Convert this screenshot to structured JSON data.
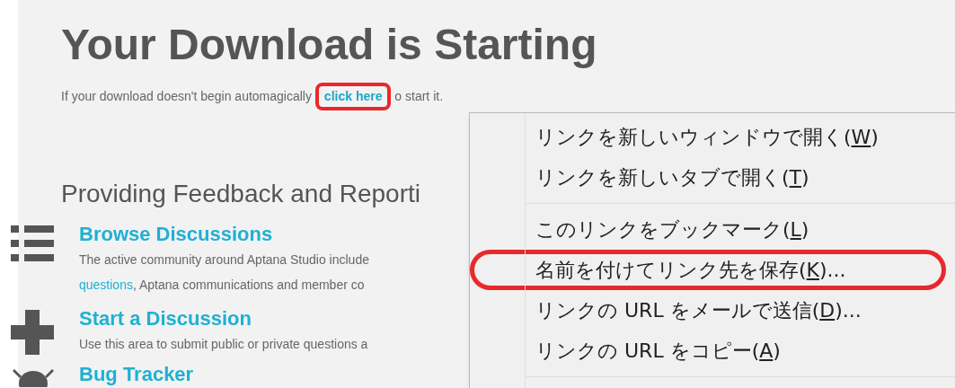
{
  "page": {
    "title": "Your Download is Starting",
    "intro": {
      "before": "If your download doesn't begin automagically",
      "link": "click here",
      "after": "o start it."
    },
    "section_heading": "Providing Feedback and Reporti",
    "items": [
      {
        "kind": "list",
        "title": "Browse Discussions",
        "lines": [
          {
            "text": "The active community around Aptana Studio include"
          },
          {
            "link": "questions",
            "text": ", Aptana communications and member co"
          }
        ]
      },
      {
        "kind": "plus",
        "title": "Start a Discussion",
        "lines": [
          {
            "text": "Use this area to submit public or private questions a"
          }
        ]
      },
      {
        "kind": "bug",
        "title": "Bug Tracker"
      }
    ]
  },
  "context_menu": {
    "groups": [
      [
        {
          "label": "リンクを新しいウィンドウで開く(",
          "key": "W",
          "after": ")",
          "highlighted": false
        },
        {
          "label": "リンクを新しいタブで開く(",
          "key": "T",
          "after": ")",
          "highlighted": false
        }
      ],
      [
        {
          "label": "このリンクをブックマーク(",
          "key": "L",
          "after": ")",
          "highlighted": false
        },
        {
          "label": "名前を付けてリンク先を保存(",
          "key": "K",
          "after": ")...",
          "highlighted": true
        },
        {
          "label": "リンクの URL をメールで送信(",
          "key": "D",
          "after": ")...",
          "highlighted": false
        },
        {
          "label": "リンクの URL をコピー(",
          "key": "A",
          "after": ")",
          "highlighted": false
        }
      ]
    ]
  }
}
